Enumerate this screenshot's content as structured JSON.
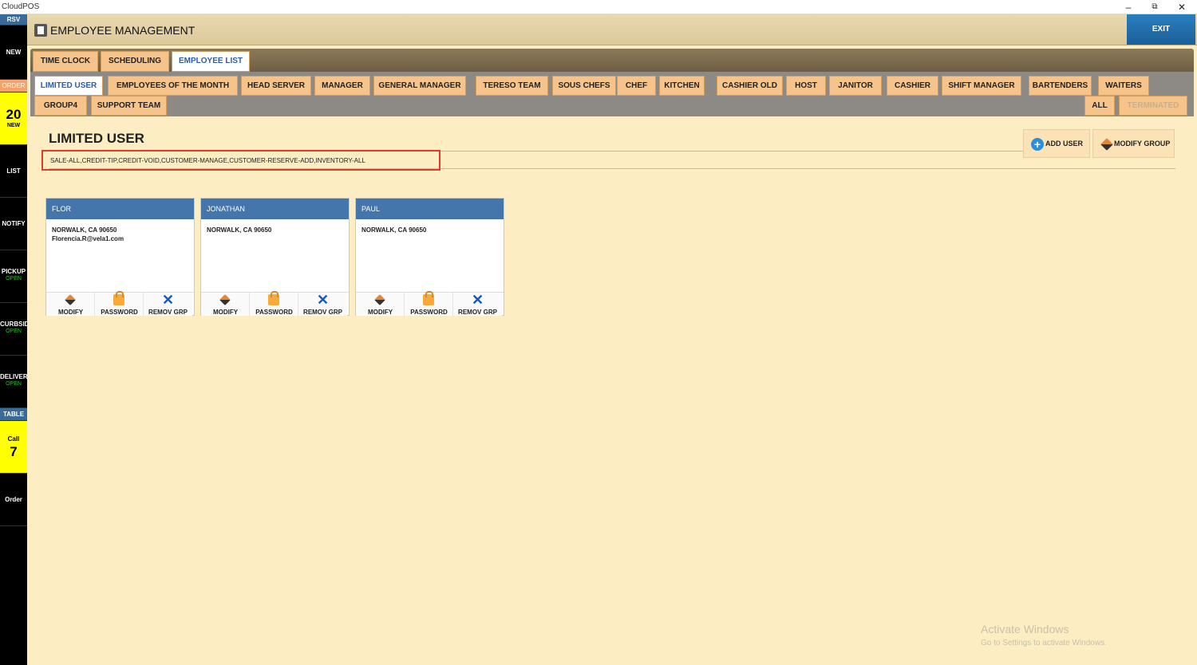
{
  "window": {
    "app_title": "CloudPOS",
    "minimize": "–",
    "restore": "⧉",
    "close": "✕"
  },
  "sidebar": {
    "rsv": "RSV",
    "new": "NEW",
    "order": "ORDER",
    "orders_count": "20",
    "orders_count_label": "NEW",
    "list": "LIST",
    "notify": "NOTIFY",
    "pickup": "PICKUP",
    "pickup_status": "OPEN",
    "curbside": "CURBSID",
    "curbside_status": "OPEN",
    "delivery": "DELIVER",
    "delivery_status": "OPEN",
    "table": "TABLE",
    "call_label": "Call",
    "call_count": "7",
    "order2": "Order"
  },
  "header": {
    "title": "EMPLOYEE MANAGEMENT",
    "exit": "EXIT"
  },
  "top_tabs": [
    {
      "label": "TIME CLOCK",
      "active": false
    },
    {
      "label": "SCHEDULING",
      "active": false
    },
    {
      "label": "EMPLOYEE LIST",
      "active": true
    }
  ],
  "group_tabs_row1": [
    "LIMITED USER",
    "EMPLOYEES OF THE MONTH",
    "HEAD SERVER",
    "MANAGER",
    "GENERAL MANAGER",
    "TERESO TEAM",
    "SOUS CHEFS",
    "CHEF",
    "KITCHEN",
    "CASHIER OLD",
    "HOST",
    "JANITOR",
    "CASHIER",
    "SHIFT MANAGER",
    "BARTENDERS",
    "WAITERS"
  ],
  "group_tabs_row2": [
    "GROUP4",
    "SUPPORT TEAM"
  ],
  "filter_tabs": {
    "all": "ALL",
    "terminated": "TERMINATED"
  },
  "group": {
    "title": "LIMITED USER",
    "permissions": "SALE-ALL,CREDIT-TIP,CREDIT-VOID,CUSTOMER-MANAGE,CUSTOMER-RESERVE-ADD,INVENTORY-ALL",
    "add_user": "ADD USER",
    "modify_group": "MODIFY GROUP"
  },
  "employees": [
    {
      "name": "FLOR",
      "address": "NORWALK, CA 90650",
      "email": "Florencia.R@vela1.com"
    },
    {
      "name": "JONATHAN",
      "address": "NORWALK, CA 90650",
      "email": ""
    },
    {
      "name": "PAUL",
      "address": "NORWALK, CA 90650",
      "email": ""
    }
  ],
  "card_actions": {
    "modify": "MODIFY",
    "password": "PASSWORD",
    "remove": "REMOV GRP"
  },
  "watermark": {
    "line1": "Activate Windows",
    "line2": "Go to Settings to activate Windows."
  }
}
